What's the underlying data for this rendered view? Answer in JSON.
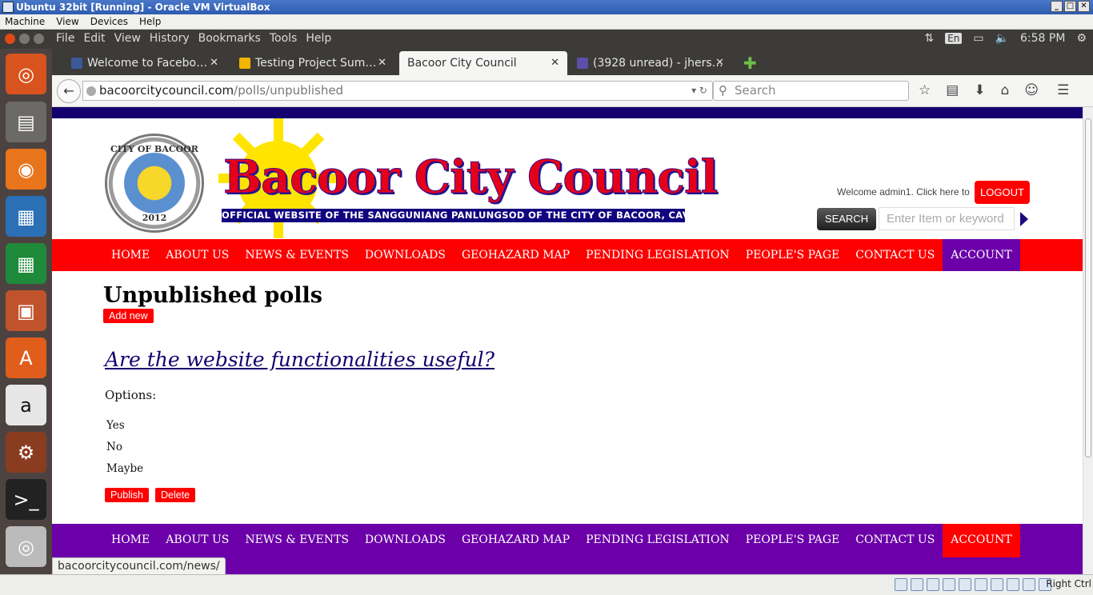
{
  "vbox": {
    "title": "Ubuntu 32bit [Running] - Oracle VM VirtualBox",
    "menu": [
      "Machine",
      "View",
      "Devices",
      "Help"
    ],
    "host_key": "Right Ctrl"
  },
  "ubuntu": {
    "app_menu": [
      "File",
      "Edit",
      "View",
      "History",
      "Bookmarks",
      "Tools",
      "Help"
    ],
    "lang": "En",
    "time": "6:58 PM"
  },
  "browser": {
    "tabs": [
      {
        "label": "Welcome to Facebo…",
        "color": "#3b5998"
      },
      {
        "label": "Testing Project Sum…",
        "color": "#f4b400"
      },
      {
        "label": "Bacoor City Council",
        "color": ""
      },
      {
        "label": "(3928 unread) - jhers…",
        "color": "#5b4fa8"
      }
    ],
    "url_host": "bacoorcitycouncil.com",
    "url_path": "/polls/unpublished",
    "search_placeholder": "Search",
    "status_link": "bacoorcitycouncil.com/news/"
  },
  "site": {
    "seal_top": "CITY OF BACOOR",
    "seal_year": "2012",
    "brand": "Bacoor City Council",
    "tagline": "OFFICIAL WEBSITE OF THE SANGGUNIANG PANLUNGSOD OF THE CITY OF BACOOR, CAVITE",
    "welcome": "Welcome admin1. Click here to",
    "logout": "LOGOUT",
    "search_button": "SEARCH",
    "search_placeholder": "Enter Item or keyword",
    "nav": [
      "HOME",
      "ABOUT US",
      "NEWS & EVENTS",
      "DOWNLOADS",
      "GEOHAZARD MAP",
      "PENDING LEGISLATION",
      "PEOPLE'S PAGE",
      "CONTACT US",
      "ACCOUNT"
    ]
  },
  "main": {
    "title": "Unpublished polls",
    "add_new": "Add new",
    "poll_question": "Are the website functionalities useful?",
    "options_label": "Options:",
    "options": [
      "Yes",
      "No",
      "Maybe"
    ],
    "publish": "Publish",
    "delete": "Delete"
  }
}
